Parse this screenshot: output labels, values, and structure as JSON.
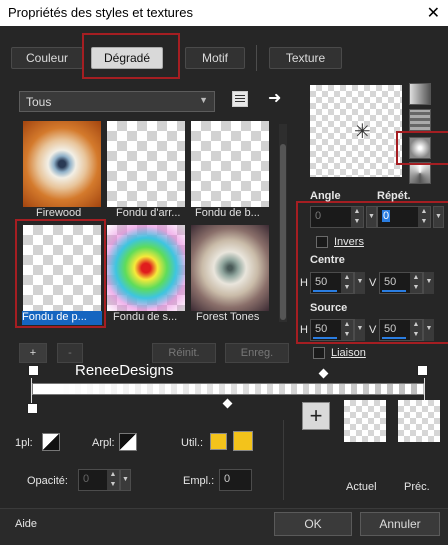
{
  "window": {
    "title": "Propriétés des styles et textures",
    "close_symbol": "✕"
  },
  "tabs": [
    {
      "label": "Couleur"
    },
    {
      "label": "Dégradé"
    },
    {
      "label": "Motif"
    },
    {
      "label": "Texture"
    }
  ],
  "library": {
    "category": "Tous"
  },
  "gradients": [
    {
      "label": "Firewood"
    },
    {
      "label": "Fondu d'arr..."
    },
    {
      "label": "Fondu de b..."
    },
    {
      "label": "Fondu de p..."
    },
    {
      "label": "Fondu de s..."
    },
    {
      "label": "Forest Tones"
    }
  ],
  "list_buttons": {
    "add": "+",
    "remove": "-",
    "reset": "Réinit.",
    "save": "Enreg."
  },
  "watermark": "ReneeDesigns",
  "params": {
    "angle_label": "Angle",
    "angle_value": "0",
    "repeat_label": "Répét.",
    "repeat_value": "0",
    "invert_label": "Invers",
    "center_label": "Centre",
    "center_h_label": "H",
    "center_h": "50",
    "center_v_label": "V",
    "center_v": "50",
    "source_label": "Source",
    "source_h_label": "H",
    "source_h": "50",
    "source_v_label": "V",
    "source_v": "50",
    "link_label": "Liaison"
  },
  "stops": {
    "left_label": "1pl:",
    "right_label": "Arpl:",
    "util_label": "Util.:",
    "opacity_label": "Opacité:",
    "opacity_value": "0",
    "position_label": "Empl.:",
    "position_value": "0",
    "util_color": "#f3c31b"
  },
  "preview": {
    "add": "+",
    "current_label": "Actuel",
    "previous_label": "Préc."
  },
  "footer": {
    "help": "Aide",
    "ok": "OK",
    "cancel": "Annuler"
  },
  "colors": {
    "accent_red": "#a51e22",
    "selection_blue": "#1565c0",
    "slider_blue": "#2a7de1"
  }
}
